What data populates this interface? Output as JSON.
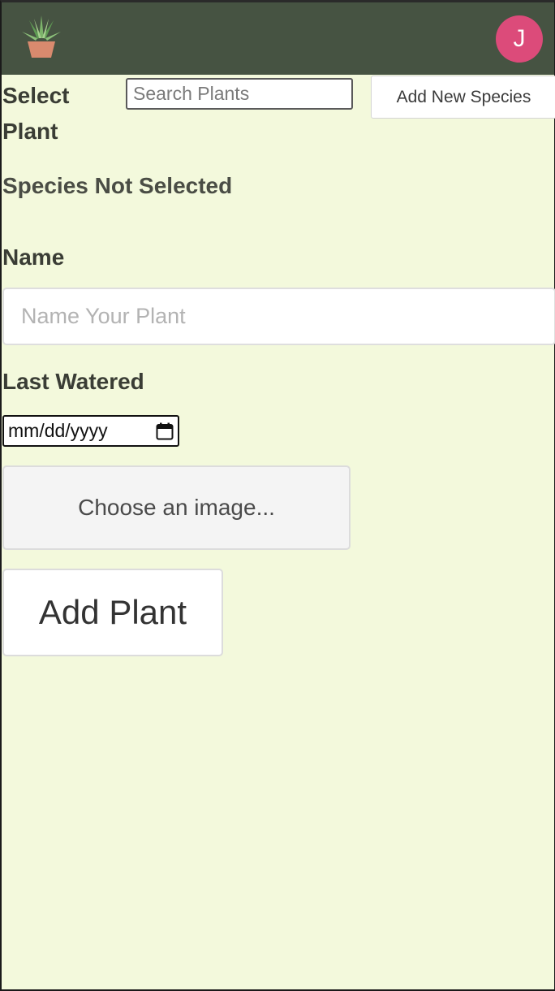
{
  "header": {
    "logo_icon": "potted-plant-icon",
    "avatar_initial": "J",
    "avatar_color": "#dc4b7a",
    "bar_color": "#465342"
  },
  "form": {
    "select_label": "Select Plant",
    "search_placeholder": "Search Plants",
    "add_species_label": "Add New Species",
    "species_status": "Species Not Selected",
    "name_label": "Name",
    "name_placeholder": "Name Your Plant",
    "watered_label": "Last Watered",
    "date_placeholder": "mm/dd/yyyy",
    "calendar_icon": "calendar-icon",
    "image_label": "Choose an image...",
    "submit_label": "Add Plant"
  },
  "colors": {
    "background": "#f3f9dc"
  }
}
